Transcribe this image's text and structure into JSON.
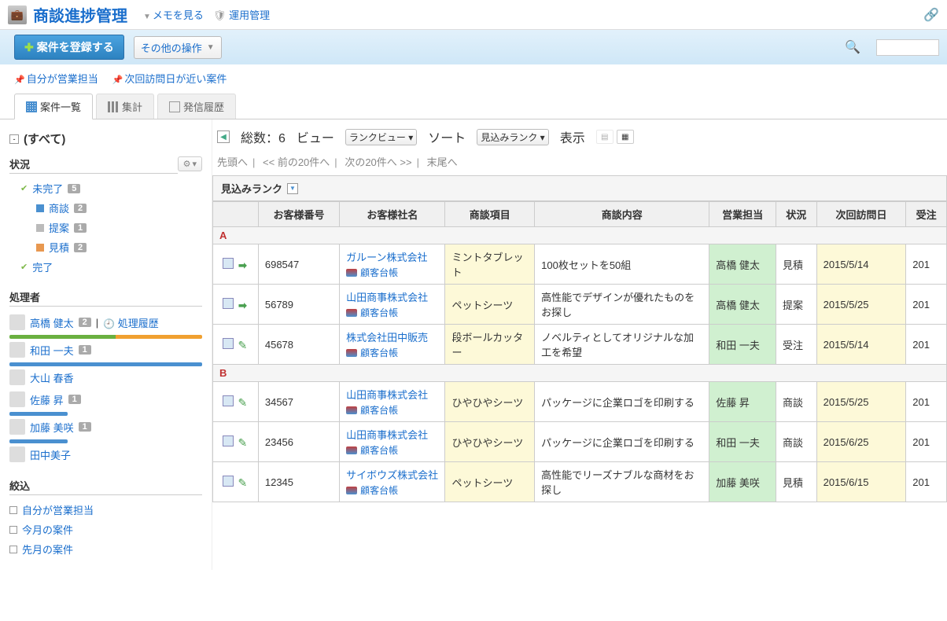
{
  "header": {
    "title": "商談進捗管理",
    "memo_link": "メモを見る",
    "admin_link": "運用管理"
  },
  "toolbar": {
    "register_btn": "案件を登録する",
    "other_ops": "その他の操作"
  },
  "filter_links": {
    "my_sales": "自分が営業担当",
    "near_visit": "次回訪問日が近い案件"
  },
  "tabs": {
    "list": "案件一覧",
    "agg": "集計",
    "log": "発信履歴"
  },
  "sidebar": {
    "all": "(すべて)",
    "status_title": "状況",
    "status": {
      "incomplete": {
        "label": "未完了",
        "count": "5"
      },
      "negotiation": {
        "label": "商談",
        "count": "2"
      },
      "proposal": {
        "label": "提案",
        "count": "1"
      },
      "estimate": {
        "label": "見積",
        "count": "2"
      },
      "complete": {
        "label": "完了"
      }
    },
    "processor_title": "処理者",
    "history_link": "処理履歴",
    "people": [
      {
        "name": "高橋 健太",
        "count": "2",
        "bar": "split"
      },
      {
        "name": "和田 一夫",
        "count": "1",
        "bar": "blue"
      },
      {
        "name": "大山 春香"
      },
      {
        "name": "佐藤 昇",
        "count": "1"
      },
      {
        "name": "加藤 美咲",
        "count": "1"
      },
      {
        "name": "田中美子"
      }
    ],
    "filter_title": "絞込",
    "filters": [
      "自分が営業担当",
      "今月の案件",
      "先月の案件"
    ]
  },
  "topbar": {
    "total_label": "総数：6",
    "view_label": "ビュー",
    "view_select": "ランクビュー",
    "sort_label": "ソート",
    "sort_select": "見込みランク",
    "display_label": "表示"
  },
  "pager": {
    "first": "先頭へ",
    "prev": "<< 前の20件へ",
    "next": "次の20件へ >>",
    "last": "末尾へ"
  },
  "group_header": "見込みランク",
  "columns": [
    "",
    "お客様番号",
    "お客様社名",
    "商談項目",
    "商談内容",
    "営業担当",
    "状況",
    "次回訪問日",
    "受注"
  ],
  "ref_label": "顧客台帳",
  "groups": [
    {
      "label": "A",
      "rows": [
        {
          "act": "arr",
          "num": "698547",
          "company": "ガルーン株式会社",
          "item": "ミントタブレット",
          "content": "100枚セットを50組",
          "sales": "高橋 健太",
          "status": "見積",
          "date": "2015/5/14",
          "ord": "201"
        },
        {
          "act": "arr",
          "num": "56789",
          "company": "山田商事株式会社",
          "item": "ペットシーツ",
          "content": "高性能でデザインが優れたものをお探し",
          "sales": "高橋 健太",
          "status": "提案",
          "date": "2015/5/25",
          "ord": "201"
        },
        {
          "act": "edit",
          "num": "45678",
          "company": "株式会社田中販売",
          "item": "段ボールカッター",
          "content": "ノベルティとしてオリジナルな加工を希望",
          "sales": "和田 一夫",
          "status": "受注",
          "date": "2015/5/14",
          "ord": "201"
        }
      ]
    },
    {
      "label": "B",
      "rows": [
        {
          "act": "edit",
          "num": "34567",
          "company": "山田商事株式会社",
          "item": "ひやひやシーツ",
          "content": "パッケージに企業ロゴを印刷する",
          "sales": "佐藤 昇",
          "status": "商談",
          "date": "2015/5/25",
          "ord": "201"
        },
        {
          "act": "edit",
          "num": "23456",
          "company": "山田商事株式会社",
          "item": "ひやひやシーツ",
          "content": "パッケージに企業ロゴを印刷する",
          "sales": "和田 一夫",
          "status": "商談",
          "date": "2015/6/25",
          "ord": "201"
        },
        {
          "act": "edit",
          "num": "12345",
          "company": "サイボウズ株式会社",
          "item": "ペットシーツ",
          "content": "高性能でリーズナブルな商材をお探し",
          "sales": "加藤 美咲",
          "status": "見積",
          "date": "2015/6/15",
          "ord": "201"
        }
      ]
    }
  ]
}
